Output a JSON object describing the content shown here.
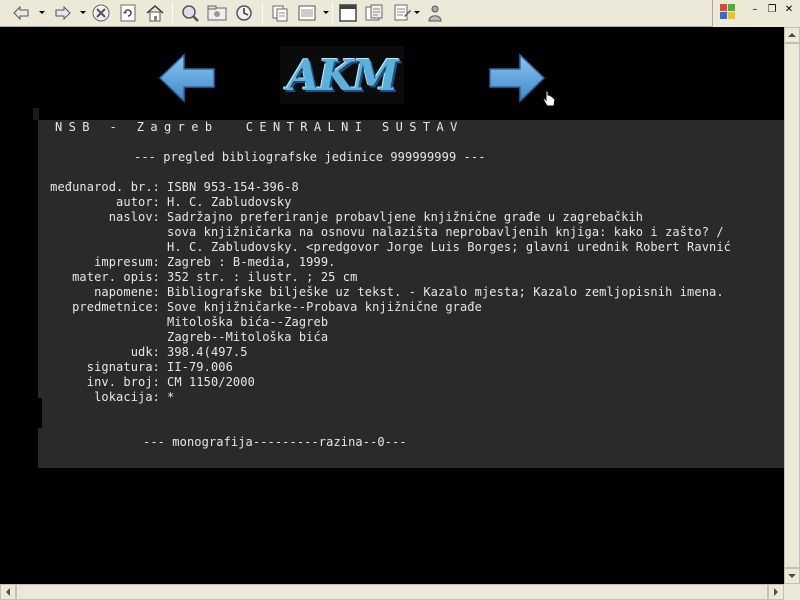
{
  "toolbar": {
    "buttons": [
      "back-icon",
      "forward-icon",
      "stop-icon",
      "refresh-icon",
      "home-icon",
      "search-icon",
      "favorites-icon",
      "history-icon",
      "mail-icon",
      "print-icon",
      "edit-icon",
      "discuss-icon",
      "messenger-icon"
    ]
  },
  "window_controls": {
    "minimize": "0",
    "restore": "1",
    "close": "r"
  },
  "nav": {
    "prev_icon": "left-arrow-icon",
    "next_icon": "right-arrow-icon",
    "logo_text": "AKM"
  },
  "record": {
    "header": "NSB - Zagreb  CENTRALNI SUSTAV",
    "subheader": "--- pregled bibliografske jedinice 999999999 ---",
    "fields": [
      {
        "label": "međunarod. br.:",
        "lines": [
          "ISBN 953-154-396-8"
        ]
      },
      {
        "label": "autor:",
        "lines": [
          "H. C. Zabludovsky"
        ]
      },
      {
        "label": "naslov:",
        "lines": [
          "Sadržajno preferiranje probavljene knjižnične građe u zagrebačkih",
          "sova knjižničarka na osnovu nalazišta neprobavljenih knjiga: kako i zašto? /",
          "H. C. Zabludovsky. <predgovor Jorge Luis Borges; glavni urednik Robert Ravnić"
        ]
      },
      {
        "label": "impresum:",
        "lines": [
          "Zagreb : B-media, 1999."
        ]
      },
      {
        "label": "mater. opis:",
        "lines": [
          "352 str. : ilustr. ; 25 cm"
        ]
      },
      {
        "label": "napomene:",
        "lines": [
          "Bibliografske bilješke uz tekst. - Kazalo mjesta; Kazalo zemljopisnih imena."
        ]
      },
      {
        "label": "predmetnice:",
        "lines": [
          "Sove knjižničarke--Probava knjižnične građe",
          "Mitološka bića--Zagreb",
          "Zagreb--Mitološka bića"
        ]
      },
      {
        "label": "udk:",
        "lines": [
          "398.4(497.5"
        ]
      },
      {
        "label": "signatura:",
        "lines": [
          "II-79.006"
        ]
      },
      {
        "label": "inv. broj:",
        "lines": [
          "CM 1150/2000"
        ]
      },
      {
        "label": "lokacija:",
        "lines": [
          "*"
        ]
      }
    ],
    "footer": "--- monografija---------razina--0---"
  },
  "colors": {
    "panel_bg": "#2a2a2a",
    "text": "#e6e6e6",
    "arrow_blue": "#5ba7e1",
    "toolbar_bg": "#ece9d8"
  }
}
